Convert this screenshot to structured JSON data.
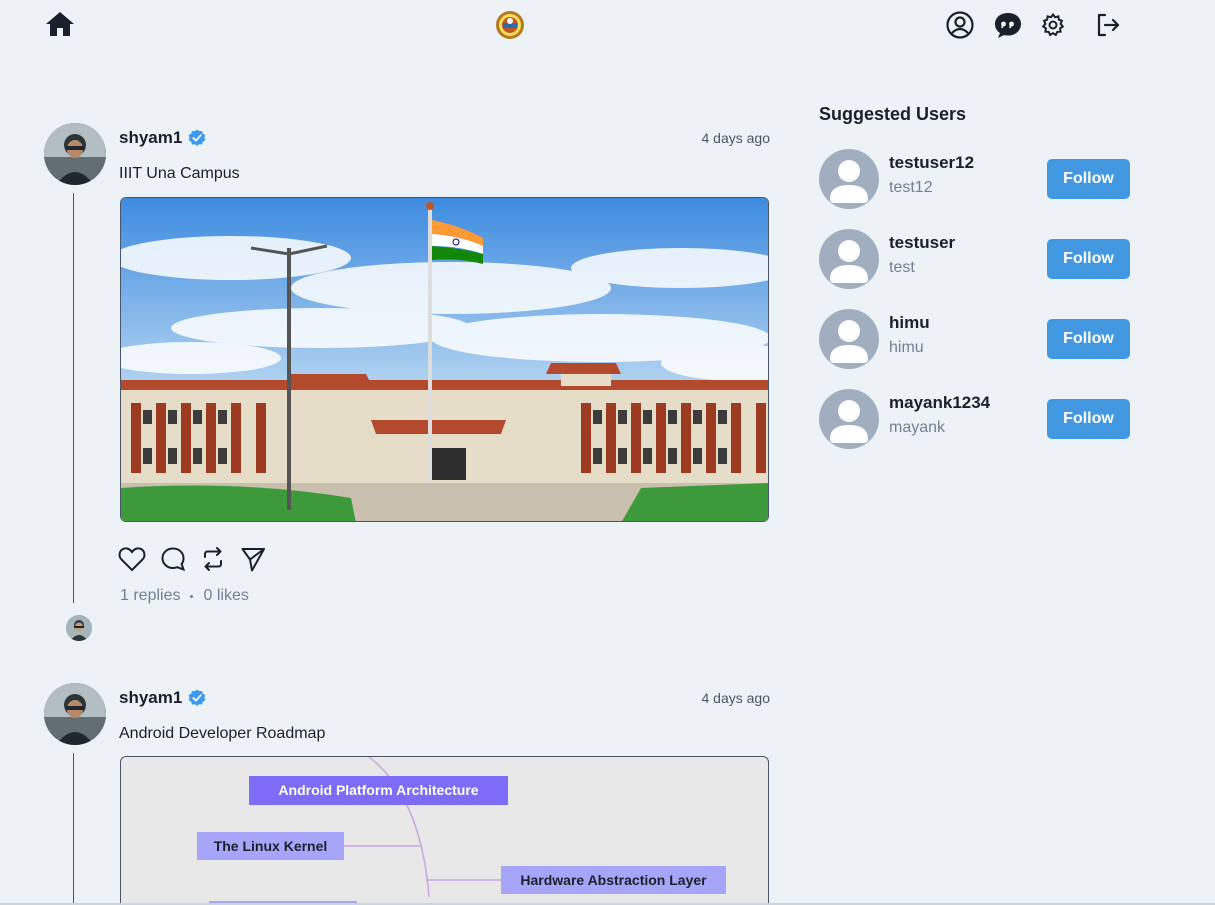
{
  "header": {
    "icons": [
      "home-icon",
      "logo-icon",
      "user-circle-icon",
      "chat-icon",
      "settings-icon",
      "logout-icon"
    ]
  },
  "feed": {
    "posts": [
      {
        "username": "shyam1",
        "verified": true,
        "time": "4 days ago",
        "text": "IIIT Una Campus",
        "replies": "1 replies",
        "likes": "0 likes"
      },
      {
        "username": "shyam1",
        "verified": true,
        "time": "4 days ago",
        "text": "Android Developer Roadmap",
        "diagram": {
          "nodes": [
            "Android Platform Architecture",
            "The Linux Kernel",
            "Hardware Abstraction Layer"
          ]
        }
      }
    ]
  },
  "suggested": {
    "title": "Suggested Users",
    "follow_label": "Follow",
    "users": [
      {
        "name": "testuser12",
        "handle": "test12"
      },
      {
        "name": "testuser",
        "handle": "test"
      },
      {
        "name": "himu",
        "handle": "himu"
      },
      {
        "name": "mayank1234",
        "handle": "mayank"
      }
    ]
  },
  "colors": {
    "background": "#edf2f7",
    "accent": "#4299e1",
    "verified": "#3b9bf0",
    "diagram_primary": "#7c6cf7",
    "diagram_secondary": "#a7a5f9"
  }
}
